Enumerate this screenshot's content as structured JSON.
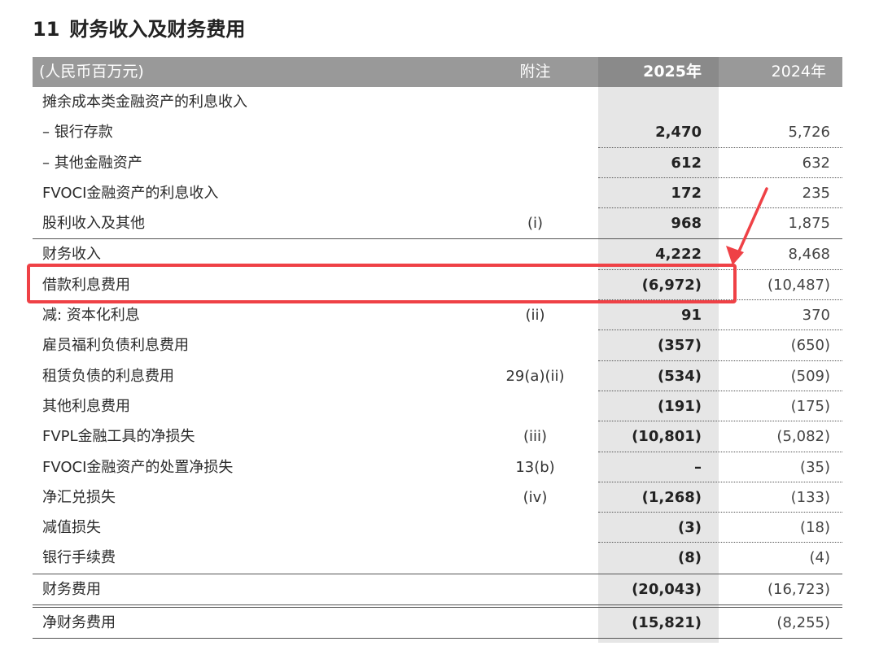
{
  "title": {
    "number": "11",
    "text": "财务收入及财务费用"
  },
  "table": {
    "header": {
      "label": "(人民币百万元)",
      "note": "附注",
      "y1": "2025年",
      "y2": "2024年"
    },
    "rows": [
      {
        "label": "摊余成本类金融资产的利息收入",
        "note": "",
        "y1": "",
        "y2": "",
        "border": "none"
      },
      {
        "label": "– 银行存款",
        "note": "",
        "y1": "2,470",
        "y2": "5,726",
        "border": "dot"
      },
      {
        "label": "– 其他金融资产",
        "note": "",
        "y1": "612",
        "y2": "632",
        "border": "dot"
      },
      {
        "label": "FVOCI金融资产的利息收入",
        "note": "",
        "y1": "172",
        "y2": "235",
        "border": "dot"
      },
      {
        "label": "股利收入及其他",
        "note": "(i)",
        "y1": "968",
        "y2": "1,875",
        "border": "solid"
      },
      {
        "label": "财务收入",
        "note": "",
        "y1": "4,222",
        "y2": "8,468",
        "border": "dot"
      },
      {
        "label": "借款利息费用",
        "note": "",
        "y1": "(6,972)",
        "y2": "(10,487)",
        "border": "dot"
      },
      {
        "label": "减: 资本化利息",
        "note": "(ii)",
        "y1": "91",
        "y2": "370",
        "border": "dot"
      },
      {
        "label": "雇员福利负债利息费用",
        "note": "",
        "y1": "(357)",
        "y2": "(650)",
        "border": "dot"
      },
      {
        "label": "租赁负债的利息费用",
        "note": "29(a)(ii)",
        "y1": "(534)",
        "y2": "(509)",
        "border": "dot"
      },
      {
        "label": "其他利息费用",
        "note": "",
        "y1": "(191)",
        "y2": "(175)",
        "border": "dot"
      },
      {
        "label": "FVPL金融工具的净损失",
        "note": "(iii)",
        "y1": "(10,801)",
        "y2": "(5,082)",
        "border": "dot"
      },
      {
        "label": "FVOCI金融资产的处置净损失",
        "note": "13(b)",
        "y1": "–",
        "y2": "(35)",
        "border": "dot"
      },
      {
        "label": "净汇兑损失",
        "note": "(iv)",
        "y1": "(1,268)",
        "y2": "(133)",
        "border": "dot"
      },
      {
        "label": "减值损失",
        "note": "",
        "y1": "(3)",
        "y2": "(18)",
        "border": "dot"
      },
      {
        "label": "银行手续费",
        "note": "",
        "y1": "(8)",
        "y2": "(4)",
        "border": "solid"
      },
      {
        "label": "财务费用",
        "note": "",
        "y1": "(20,043)",
        "y2": "(16,723)",
        "border": "double"
      },
      {
        "label": "净财务费用",
        "note": "",
        "y1": "(15,821)",
        "y2": "(8,255)",
        "border": "solid"
      }
    ]
  },
  "annotation": {
    "highlight_color": "#ef4146",
    "arrow_color": "#ef4146"
  }
}
